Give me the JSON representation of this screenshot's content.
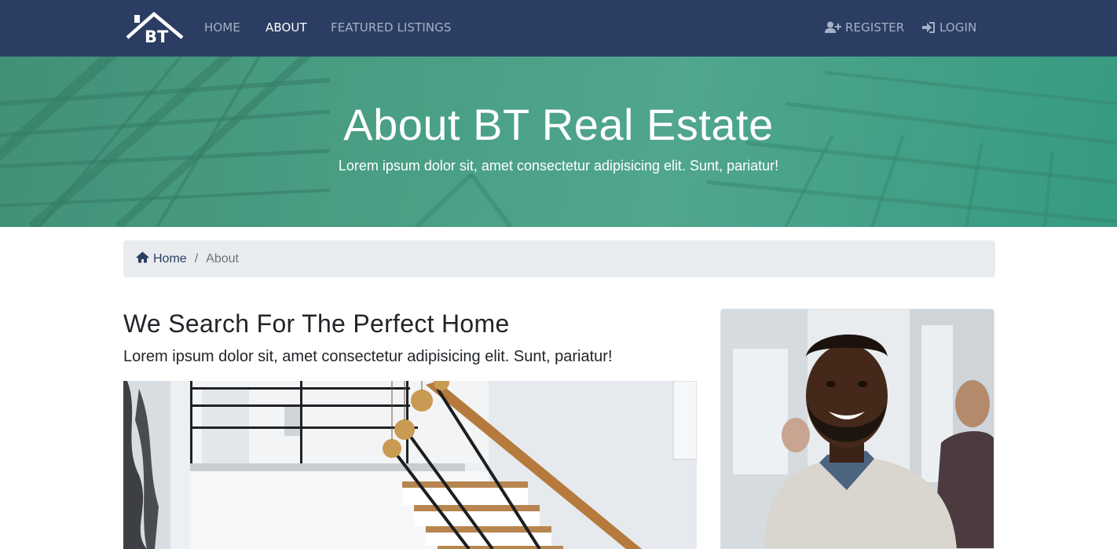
{
  "navbar": {
    "logo_text": "BT",
    "links": [
      {
        "label": "HOME",
        "active": false
      },
      {
        "label": "ABOUT",
        "active": true
      },
      {
        "label": "FEATURED LISTINGS",
        "active": false
      }
    ],
    "register_label": "REGISTER",
    "login_label": "LOGIN",
    "colors": {
      "background": "#2b3d63",
      "link": "#a7b1c5",
      "active": "#ffffff"
    }
  },
  "hero": {
    "title": "About BT Real Estate",
    "subtitle": "Lorem ipsum dolor sit, amet consectetur adipisicing elit. Sunt, pariatur!",
    "color": "#4aa186"
  },
  "breadcrumb": {
    "home_label": "Home",
    "separator": "/",
    "current": "About",
    "icon": "home-icon"
  },
  "content": {
    "heading": "We Search For The Perfect Home",
    "lead": "Lorem ipsum dolor sit, amet consectetur adipisicing elit. Sunt, pariatur!",
    "image_subject": "staircase-interior",
    "card_image_subject": "smiling-realtor-portrait"
  }
}
